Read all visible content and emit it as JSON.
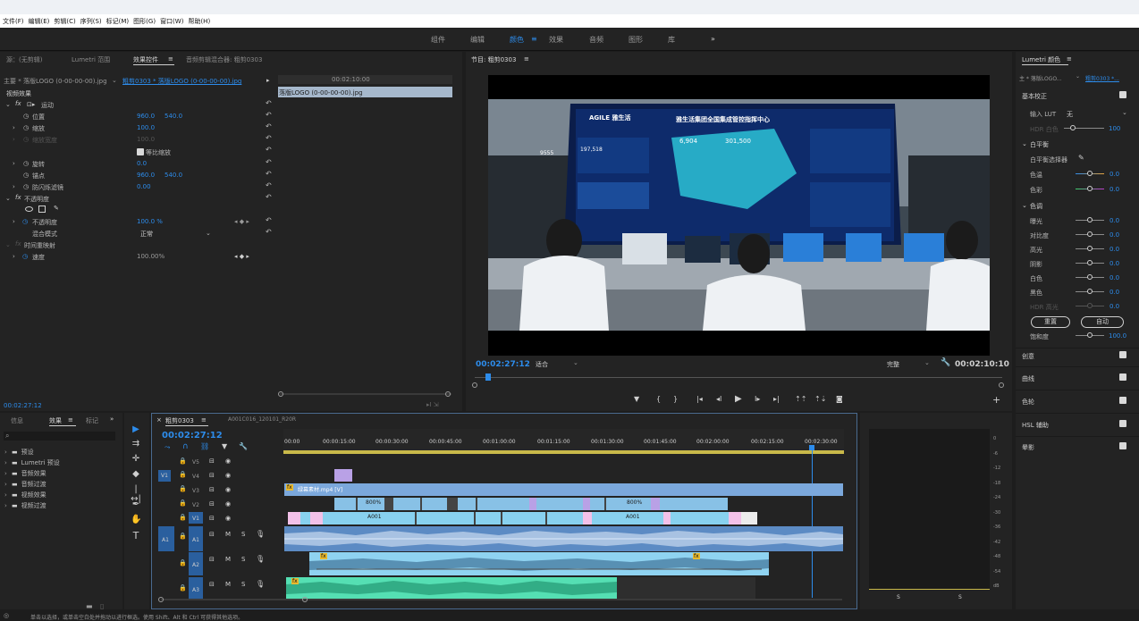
{
  "menu": [
    "文件(F)",
    "编辑(E)",
    "剪辑(C)",
    "序列(S)",
    "标记(M)",
    "图形(G)",
    "窗口(W)",
    "帮助(H)"
  ],
  "workspaces": [
    "组件",
    "编辑",
    "颜色",
    "效果",
    "音频",
    "图形",
    "库"
  ],
  "workspace_active": "颜色",
  "workspace_more": "»",
  "source_tabs": [
    "源：(无剪辑)",
    "Lumetri 范围",
    "效果控件",
    "音频剪辑混合器: 粗剪0303"
  ],
  "effect_controls": {
    "master": "主要 * 落版LOGO (0-00-00-00).jpg",
    "clip": "粗剪0303 * 落版LOGO (0-00-00-00).jpg",
    "timecode": "00:02:10:00",
    "clip_bar": "落版LOGO (0-00-00-00).jpg",
    "section_video": "视频效果",
    "motion": "运动",
    "position": "位置",
    "position_x": "960.0",
    "position_y": "540.0",
    "scale": "缩放",
    "scale_v": "100.0",
    "scale_width": "缩放宽度",
    "scale_width_v": "100.0",
    "uniform": "等比缩放",
    "rotation": "旋转",
    "rotation_v": "0.0",
    "anchor": "锚点",
    "anchor_x": "960.0",
    "anchor_y": "540.0",
    "antiflicker": "防闪烁滤镜",
    "antiflicker_v": "0.00",
    "opacity_fx": "不透明度",
    "opacity": "不透明度",
    "opacity_v": "100.0 %",
    "blend": "混合模式",
    "blend_v": "正常",
    "remap": "时间重映射",
    "speed": "速度",
    "speed_v": "100.00%",
    "current_time": "00:02:27:12"
  },
  "program": {
    "title": "节目: 粗剪0303",
    "timecode": "00:02:27:12",
    "fit": "适合",
    "quality": "完整",
    "duration": "00:02:10:10"
  },
  "screen_text": {
    "logo": "AGILE 雅生活",
    "headline": "雅生活集团全国集成管控指挥中心",
    "n1": "6,904",
    "n2": "301,500",
    "n3": "9555",
    "n4": "197,518"
  },
  "project_tabs": [
    "信息",
    "效果",
    "标记"
  ],
  "effects_folders": [
    "预设",
    "Lumetri 预设",
    "音频效果",
    "音频过渡",
    "视频效果",
    "视频过渡"
  ],
  "timeline": {
    "tabs": [
      "粗剪0303",
      "A001C016_120101_R20R"
    ],
    "timecode": "00:02:27:12",
    "ruler": [
      "00:00",
      "00:00:15:00",
      "00:00:30:00",
      "00:00:45:00",
      "00:01:00:00",
      "00:01:15:00",
      "00:01:30:00",
      "00:01:45:00",
      "00:02:00:00",
      "00:02:15:00",
      "00:02:30:00"
    ],
    "tracks_v": [
      "V5",
      "V4",
      "V3",
      "V2",
      "V1"
    ],
    "tracks_a": [
      "A1",
      "A2",
      "A3"
    ],
    "v3_clip": "绿幕素材.mp4 [V]",
    "v2_labels": [
      "800%",
      "800%"
    ],
    "v1_labels": [
      "A001",
      "A001"
    ],
    "meter_db": [
      "0",
      "-6",
      "-12",
      "-18",
      "-24",
      "-30",
      "-36",
      "-42",
      "-48",
      "-54",
      "dB"
    ],
    "meter_s": [
      "S",
      "S"
    ]
  },
  "lumetri": {
    "title": "Lumetri 颜色",
    "master": "主 * 落版LOGO...",
    "seq": "粗剪0303 *...",
    "basic": "基本校正",
    "input_lut": "输入 LUT",
    "input_lut_v": "无",
    "hdr_white": "HDR 白色",
    "hdr_white_v": "100",
    "wb": "白平衡",
    "wb_picker": "白平衡选择器",
    "temp": "色温",
    "temp_v": "0.0",
    "tint": "色彩",
    "tint_v": "0.0",
    "tone": "色调",
    "exposure": "曝光",
    "contrast": "对比度",
    "highlights": "高光",
    "shadows": "阴影",
    "whites": "白色",
    "blacks": "黑色",
    "hdr_spec": "HDR 高光",
    "reset": "重置",
    "auto": "自动",
    "saturation": "饱和度",
    "saturation_v": "100.0",
    "zero": "0.0",
    "sections": [
      "创意",
      "曲线",
      "色轮",
      "HSL 辅助",
      "晕影"
    ]
  },
  "status": "单击以选择，或单击空白处并拖动以进行框选。使用 Shift、Alt 和 Ctrl 可获得其他选项。"
}
